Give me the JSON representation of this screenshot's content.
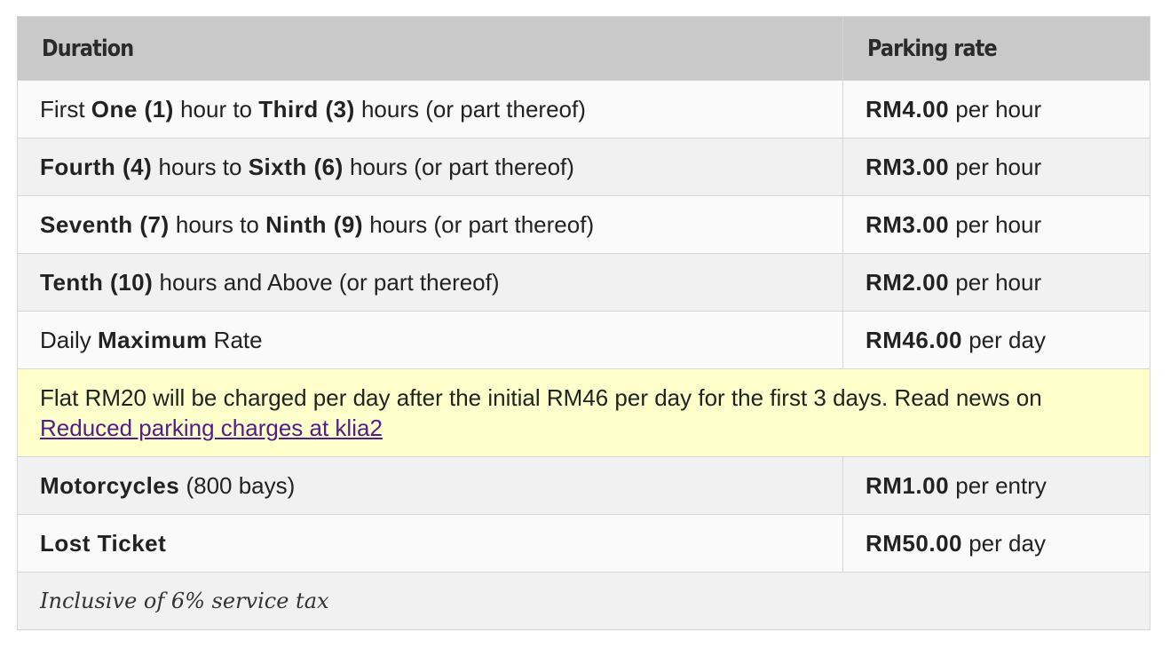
{
  "header": {
    "col1": "Duration",
    "col2": "Parking rate"
  },
  "rows": [
    {
      "d": [
        "First ",
        "One (1)",
        " hour to ",
        "Third (3)",
        " hours (or part thereof)"
      ],
      "rate": "RM4.00",
      "unit": " per hour"
    },
    {
      "d": [
        "",
        "Fourth (4)",
        " hours to ",
        "Sixth (6)",
        " hours (or part thereof)"
      ],
      "rate": "RM3.00",
      "unit": " per hour"
    },
    {
      "d": [
        "",
        "Seventh (7)",
        " hours to ",
        "Ninth (9)",
        " hours (or part thereof)"
      ],
      "rate": "RM3.00",
      "unit": " per hour"
    },
    {
      "d": [
        "",
        "Tenth (10)",
        " hours and Above (or part thereof)"
      ],
      "rate": "RM2.00",
      "unit": " per hour"
    },
    {
      "d": [
        "Daily ",
        "Maximum",
        " Rate"
      ],
      "rate": "RM46.00",
      "unit": " per day"
    }
  ],
  "note": {
    "text": "Flat RM20 will be charged per day after the initial RM46 per day for the first 3 days. Read news on ",
    "link": "Reduced parking charges at klia2"
  },
  "extra_rows": [
    {
      "bold": "Motorcycles",
      "rest": " (800 bays)",
      "rate": "RM1.00",
      "unit": " per entry"
    },
    {
      "bold": "Lost Ticket",
      "rest": "",
      "rate": "RM50.00",
      "unit": " per day"
    }
  ],
  "footer": {
    "tax_note": "Inclusive of 6% service tax"
  }
}
